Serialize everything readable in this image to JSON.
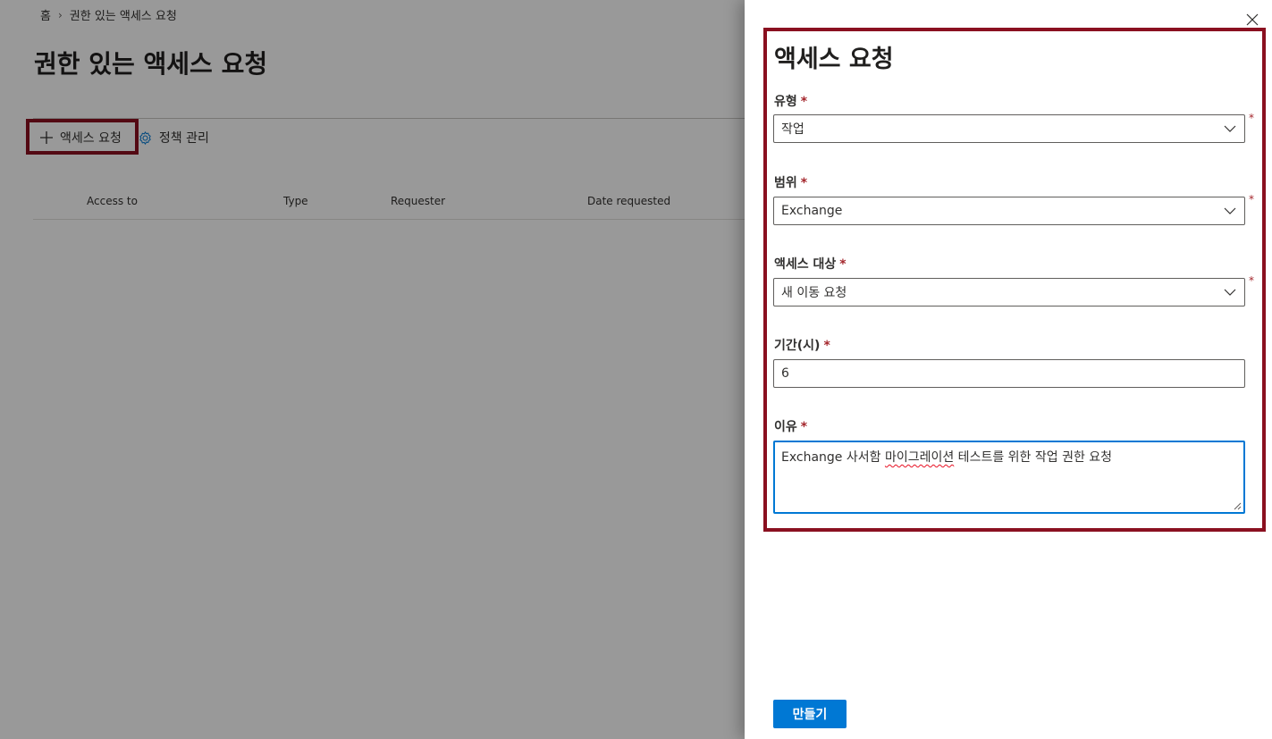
{
  "breadcrumb": {
    "home": "홈",
    "current": "권한 있는 액세스 요청"
  },
  "page": {
    "title": "권한 있는 액세스 요청"
  },
  "commands": {
    "request_access": "액세스 요청",
    "manage_policies": "정책 관리"
  },
  "table": {
    "columns": [
      "Access to",
      "Type",
      "Requester",
      "Date requested"
    ]
  },
  "panel": {
    "title": "액세스 요청",
    "type": {
      "label": "유형",
      "required": "*",
      "value": "작업"
    },
    "scope": {
      "label": "범위",
      "required": "*",
      "value": "Exchange"
    },
    "access_to": {
      "label": "액세스 대상",
      "required": "*",
      "value": "새 이동 요청"
    },
    "duration": {
      "label": "기간(시)",
      "required": "*",
      "value": "6"
    },
    "reason": {
      "label": "이유",
      "required": "*",
      "value_prefix": "Exchange 사서함 ",
      "value_misspelled": "마이그레이션",
      "value_suffix": " 테스트를 위한 작업 권한 요청"
    },
    "create_button": "만들기"
  },
  "colors": {
    "accent": "#0078d4",
    "highlight": "#8a1020",
    "required": "#a4262c"
  }
}
